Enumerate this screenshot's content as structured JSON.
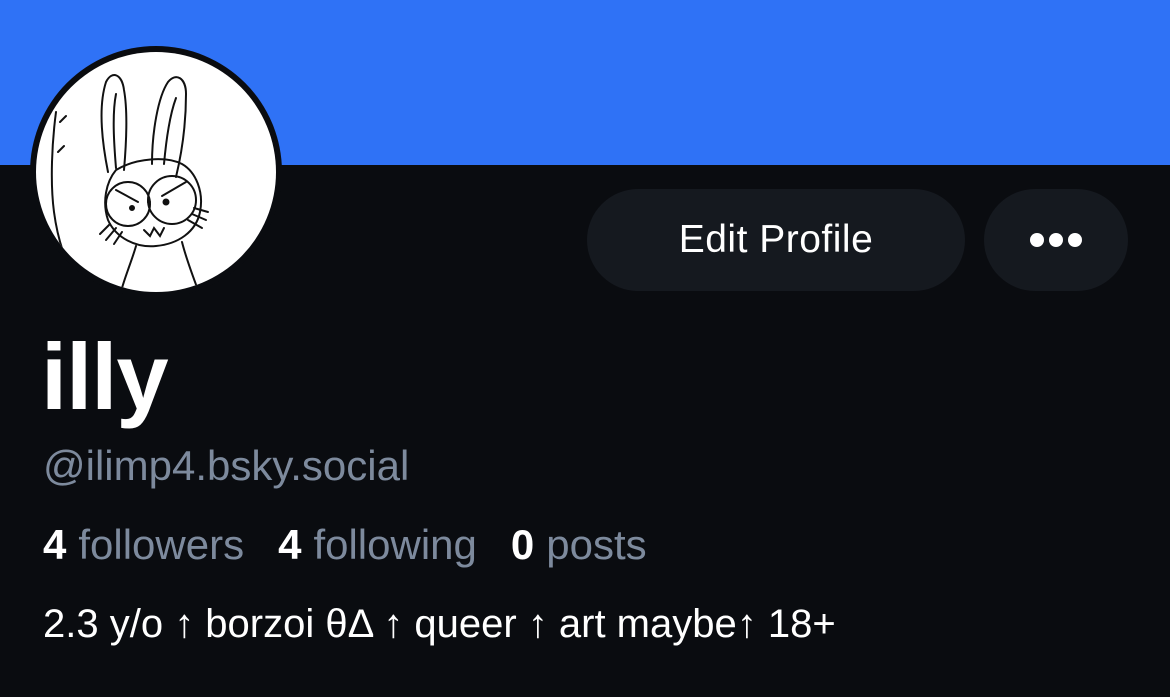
{
  "banner": {
    "color": "#2f72f6"
  },
  "colors": {
    "background": "#0a0c10",
    "button_bg": "#15191f",
    "muted_text": "#7d8a9d"
  },
  "avatar": {
    "description_icon": "bunny-sketch-avatar"
  },
  "actions": {
    "edit_profile_label": "Edit Profile",
    "more_icon": "ellipsis-icon"
  },
  "profile": {
    "display_name": "illy",
    "handle": "@ilimp4.bsky.social",
    "bio": "2.3 y/o ↑ borzoi θΔ ↑ queer ↑ art maybe↑ 18+"
  },
  "stats": {
    "followers": {
      "count": "4",
      "label": "followers"
    },
    "following": {
      "count": "4",
      "label": "following"
    },
    "posts": {
      "count": "0",
      "label": "posts"
    }
  }
}
